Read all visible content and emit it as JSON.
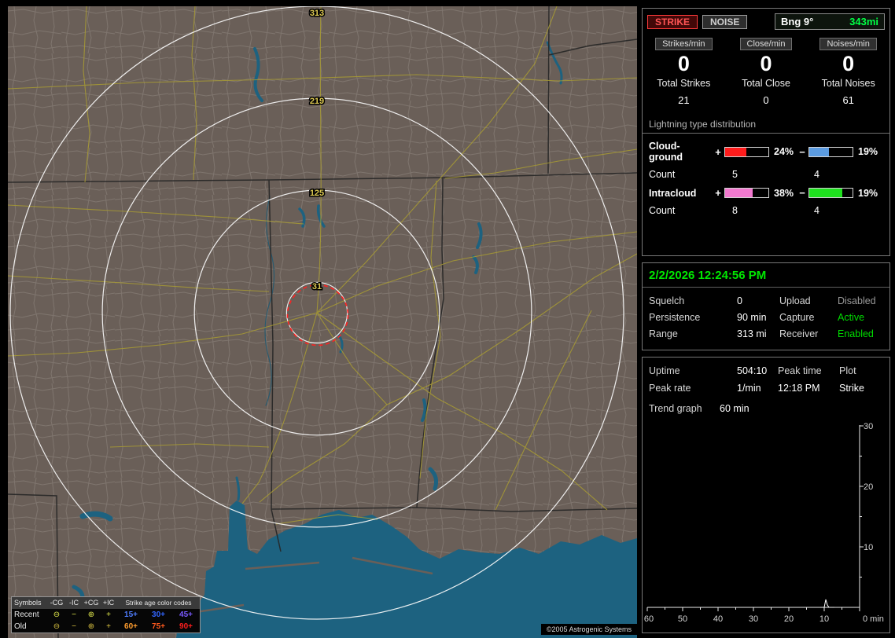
{
  "map": {
    "ring_labels": [
      "313",
      "219",
      "125",
      "31"
    ],
    "copyright": "©2005 Astrogenic Systems",
    "colors": {
      "land": "#6a5f58",
      "water": "#1d6280",
      "ring": "#fafafa",
      "alarm_ring": "#ff2222",
      "road": "#a89b33"
    },
    "legend": {
      "symbols_label": "Symbols",
      "columns": [
        "-CG",
        "-IC",
        "+CG",
        "+IC"
      ],
      "symbols": [
        "⊖",
        "−",
        "⊕",
        "+"
      ],
      "age_title": "Strike age color codes",
      "rows": [
        {
          "label": "Recent",
          "symbol_color": "#e0e84c",
          "ages": [
            {
              "text": "15+",
              "color": "#4f7dff"
            },
            {
              "text": "30+",
              "color": "#3366ff"
            },
            {
              "text": "45+",
              "color": "#7a5aff"
            }
          ]
        },
        {
          "label": "Old",
          "symbol_color": "#d8c040",
          "ages": [
            {
              "text": "60+",
              "color": "#ff9d2e"
            },
            {
              "text": "75+",
              "color": "#ff5a1e"
            },
            {
              "text": "90+",
              "color": "#ff1e1e"
            }
          ]
        }
      ]
    }
  },
  "sidebar": {
    "mode": {
      "strike": "STRIKE",
      "noise": "NOISE",
      "bearing": "Bng 9°",
      "range": "343mi",
      "range_color": "#00ff44"
    },
    "rates": [
      {
        "label": "Strikes/min",
        "value": "0"
      },
      {
        "label": "Close/min",
        "value": "0"
      },
      {
        "label": "Noises/min",
        "value": "0"
      }
    ],
    "totals": [
      {
        "label": "Total Strikes",
        "value": "21"
      },
      {
        "label": "Total Close",
        "value": "0"
      },
      {
        "label": "Total Noises",
        "value": "61"
      }
    ],
    "distribution": {
      "title": "Lightning type distribution",
      "count_label": "Count",
      "rows": [
        {
          "name": "Cloud-ground",
          "plus": "+",
          "minus": "−",
          "pos_pct": "24%",
          "pos_fill": "49%",
          "pos_color": "#ff1c1c",
          "pos_count": "5",
          "neg_pct": "19%",
          "neg_fill": "46%",
          "neg_color": "#5b9be0",
          "neg_count": "4"
        },
        {
          "name": "Intracloud",
          "plus": "+",
          "minus": "−",
          "pos_pct": "38%",
          "pos_fill": "63%",
          "pos_color": "#f279cf",
          "pos_count": "8",
          "neg_pct": "19%",
          "neg_fill": "77%",
          "neg_color": "#1ee11e",
          "neg_count": "4"
        }
      ]
    },
    "status": {
      "datetime": "2/2/2026 12:24:56 PM",
      "rows": [
        {
          "l1": "Squelch",
          "v1": "0",
          "l2": "Upload",
          "v2": "Disabled",
          "v2_color": "#999999"
        },
        {
          "l1": "Persistence",
          "v1": "90 min",
          "l2": "Capture",
          "v2": "Active",
          "v2_color": "#00dd00"
        },
        {
          "l1": "Range",
          "v1": "313 mi",
          "l2": "Receiver",
          "v2": "Enabled",
          "v2_color": "#00dd00"
        }
      ]
    },
    "info": {
      "uptime_label": "Uptime",
      "uptime_value": "504:10",
      "peak_time_label": "Peak time",
      "peak_time_value": "12:18 PM",
      "plot_label": "Plot",
      "plot_value": "Strike",
      "peak_rate_label": "Peak rate",
      "peak_rate_value": "1/min",
      "trend_label": "Trend graph",
      "trend_value": "60 min"
    },
    "graph": {
      "x_ticks": [
        "60",
        "50",
        "40",
        "30",
        "20",
        "10"
      ],
      "x_origin": "0 min",
      "y_ticks": [
        "30",
        "20",
        "10"
      ]
    }
  }
}
